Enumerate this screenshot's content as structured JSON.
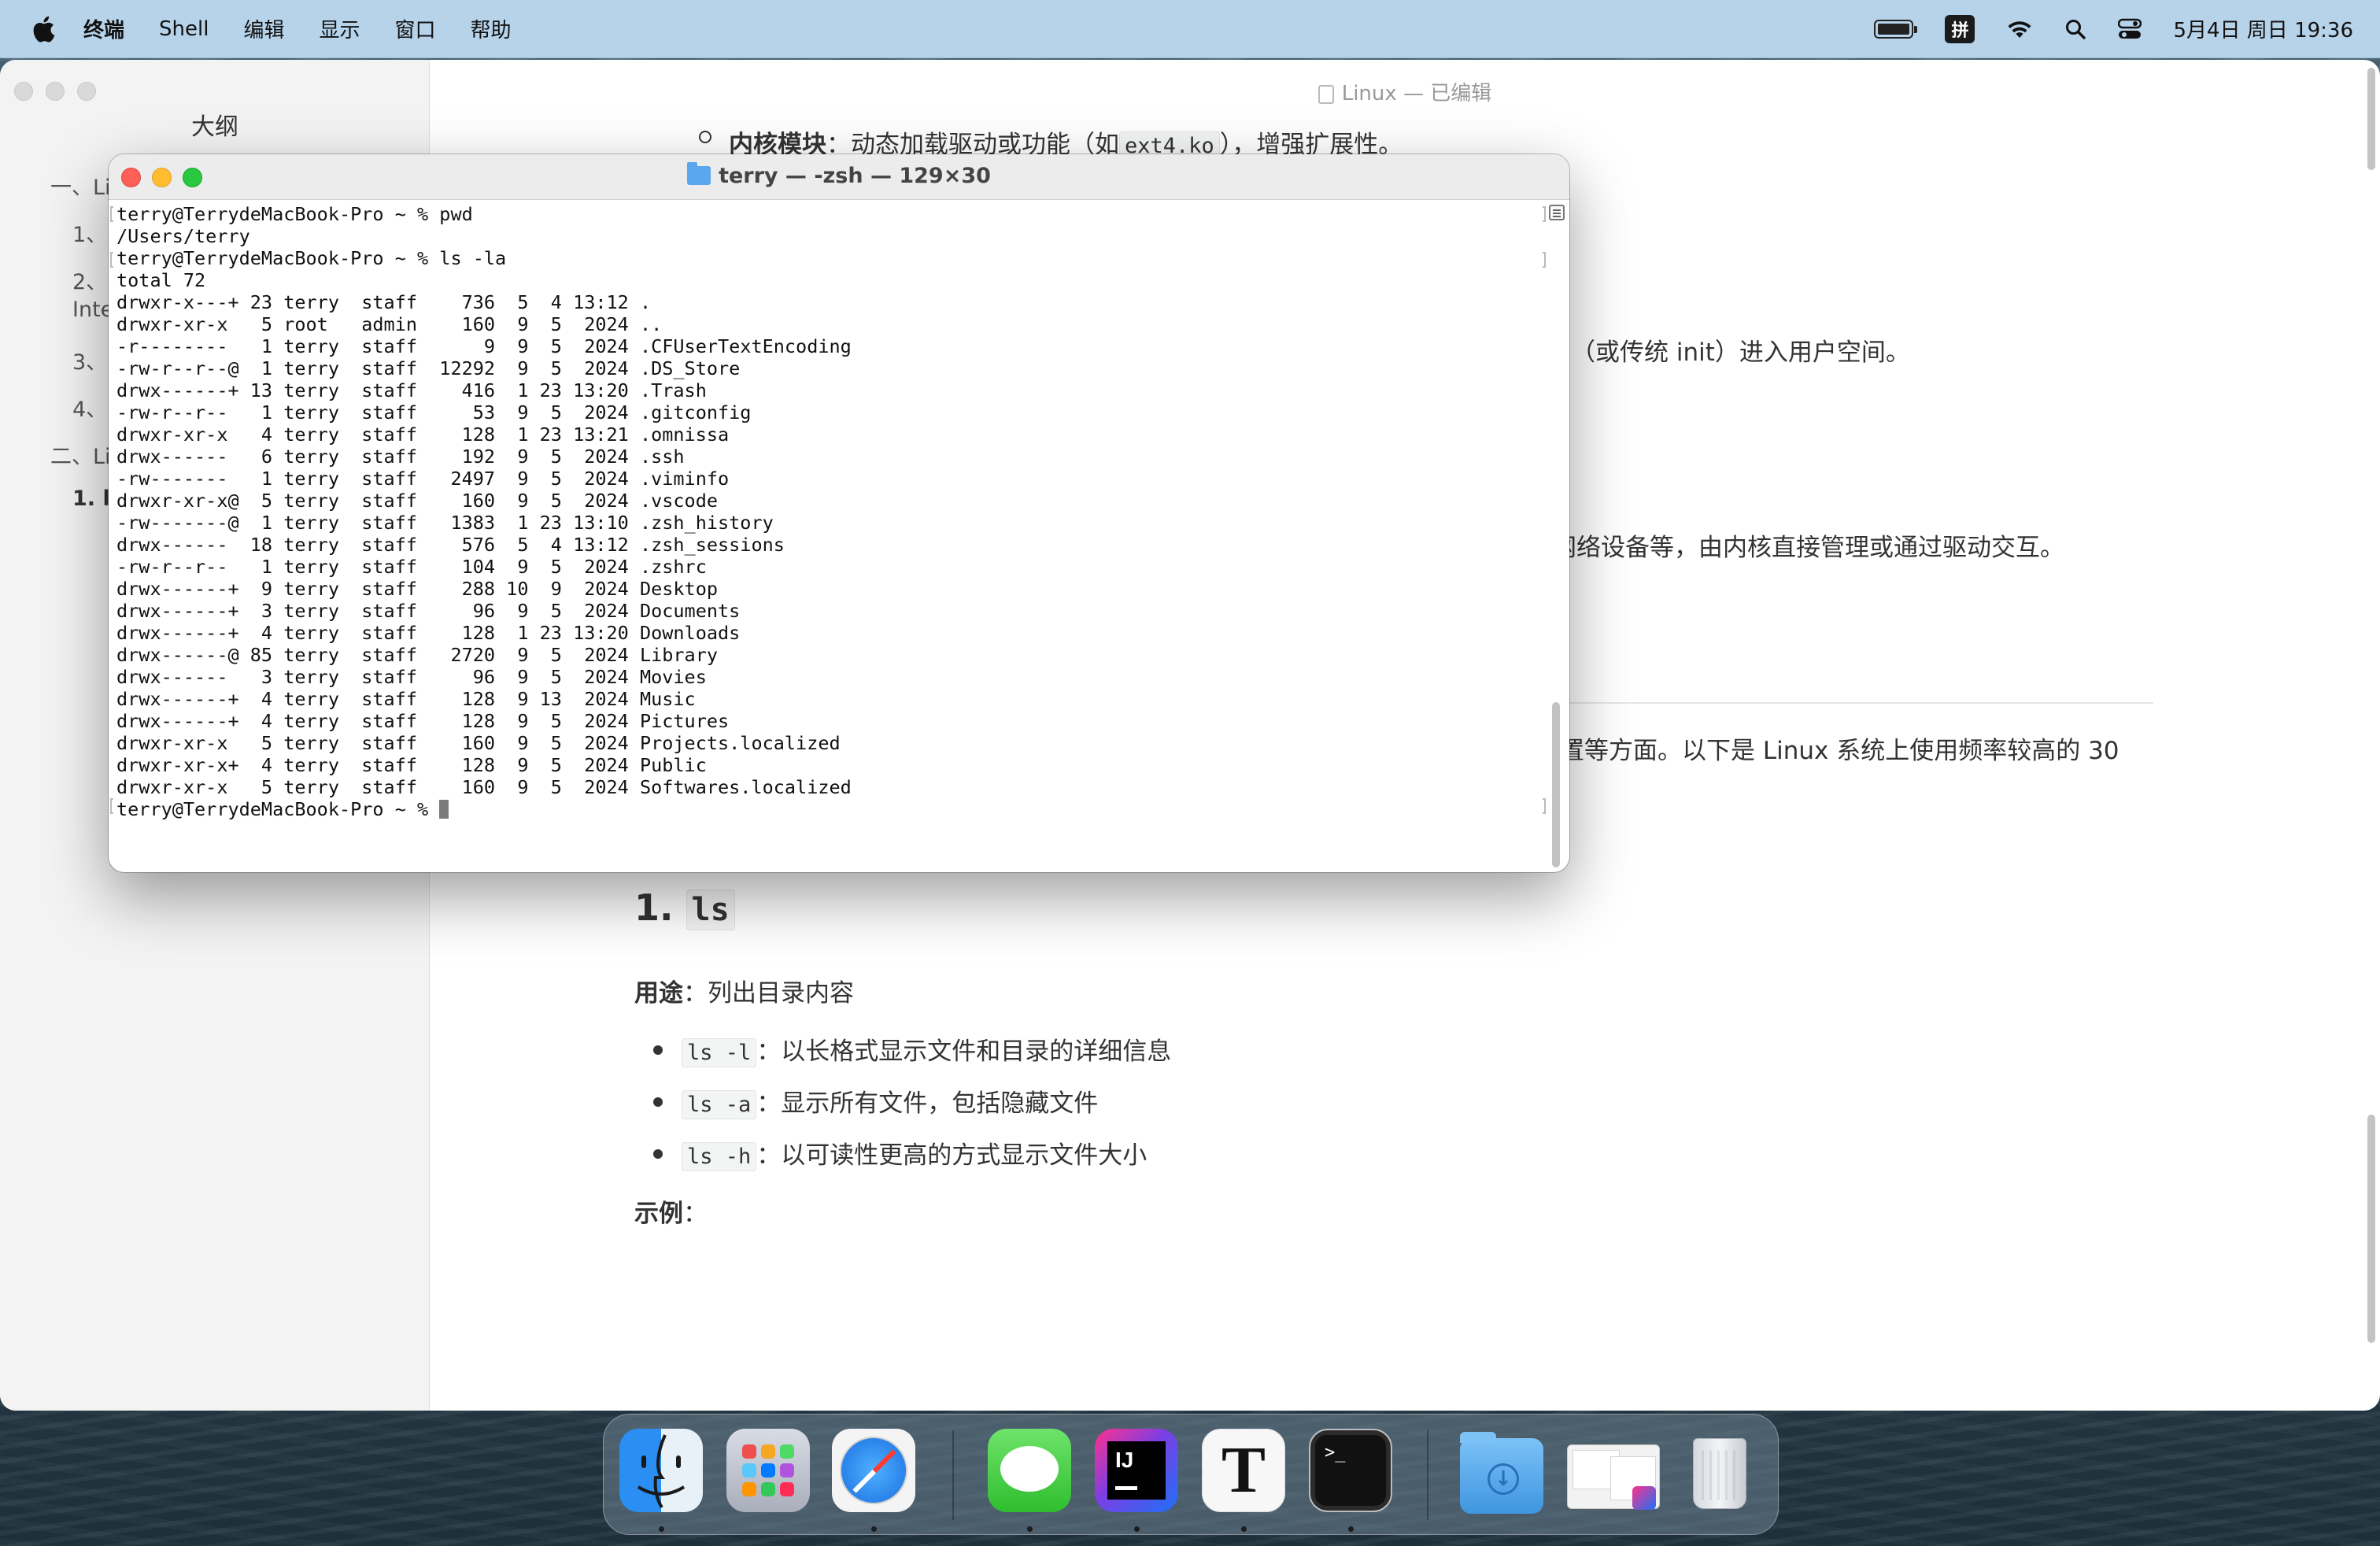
{
  "menubar": {
    "app_name": "终端",
    "items": [
      "Shell",
      "编辑",
      "显示",
      "窗口",
      "帮助"
    ],
    "input_method": "拼",
    "datetime": "5月4日 周日 19:36"
  },
  "editor": {
    "title": "Linux — 已编辑",
    "outline_title": "大纲",
    "outline_items": [
      "一、Li",
      "1、",
      "2、",
      "Inte",
      "3、",
      "4、",
      "二、Li",
      "1. l"
    ],
    "line_kernel_module_label": "内核模块",
    "line_kernel_module_text": "：动态加载驱动或功能（如",
    "line_kernel_module_code": "ext4.ko",
    "line_kernel_module_tail": "），增强扩展性。",
    "line_init": "（或传统 init）进入用户空间。",
    "line_devices": "网络设备等，由内核直接管理或通过驱动交互。",
    "line_intro": "置等方面。以下是 Linux 系统上使用频率较高的 30",
    "heading_number": "1.",
    "heading_code": "ls",
    "usage_label": "用途",
    "usage_text": "：列出目录内容",
    "bullets": [
      {
        "code": "ls -l",
        "text": "：以长格式显示文件和目录的详细信息"
      },
      {
        "code": "ls -a",
        "text": "：显示所有文件，包括隐藏文件"
      },
      {
        "code": "ls -h",
        "text": "：以可读性更高的方式显示文件大小"
      }
    ],
    "example_label": "示例",
    "example_colon": "："
  },
  "terminal": {
    "title": "terry — -zsh — 129×30",
    "lines": [
      "terry@TerrydeMacBook-Pro ~ % pwd",
      "/Users/terry",
      "terry@TerrydeMacBook-Pro ~ % ls -la",
      "total 72",
      "drwxr-x---+ 23 terry  staff    736  5  4 13:12 .",
      "drwxr-xr-x   5 root   admin    160  9  5  2024 ..",
      "-r--------   1 terry  staff      9  9  5  2024 .CFUserTextEncoding",
      "-rw-r--r--@  1 terry  staff  12292  9  5  2024 .DS_Store",
      "drwx------+ 13 terry  staff    416  1 23 13:20 .Trash",
      "-rw-r--r--   1 terry  staff     53  9  5  2024 .gitconfig",
      "drwxr-xr-x   4 terry  staff    128  1 23 13:21 .omnissa",
      "drwx------   6 terry  staff    192  9  5  2024 .ssh",
      "-rw-------   1 terry  staff   2497  9  5  2024 .viminfo",
      "drwxr-xr-x@  5 terry  staff    160  9  5  2024 .vscode",
      "-rw-------@  1 terry  staff   1383  1 23 13:10 .zsh_history",
      "drwx------  18 terry  staff    576  5  4 13:12 .zsh_sessions",
      "-rw-r--r--   1 terry  staff    104  9  5  2024 .zshrc",
      "drwx------+  9 terry  staff    288 10  9  2024 Desktop",
      "drwx------+  3 terry  staff     96  9  5  2024 Documents",
      "drwx------+  4 terry  staff    128  1 23 13:20 Downloads",
      "drwx------@ 85 terry  staff   2720  9  5  2024 Library",
      "drwx------   3 terry  staff     96  9  5  2024 Movies",
      "drwx------+  4 terry  staff    128  9 13  2024 Music",
      "drwx------+  4 terry  staff    128  9  5  2024 Pictures",
      "drwxr-xr-x   5 terry  staff    160  9  5  2024 Projects.localized",
      "drwxr-xr-x+  4 terry  staff    128  9  5  2024 Public",
      "drwxr-xr-x   5 terry  staff    160  9  5  2024 Softwares.localized"
    ],
    "prompt": "terry@TerrydeMacBook-Pro ~ % "
  },
  "dock": {
    "apps": [
      "finder",
      "launchpad",
      "safari",
      "messages",
      "intellij-idea",
      "typora",
      "terminal",
      "downloads",
      "stack",
      "trash"
    ],
    "intellij_label": "IJ",
    "typora_label": "T",
    "terminal_label": ">_"
  },
  "colors": {
    "menubar_bg": "#b7d3ea",
    "traffic_red": "#fe5f57",
    "traffic_yellow": "#febc2e",
    "traffic_green": "#28c840"
  }
}
